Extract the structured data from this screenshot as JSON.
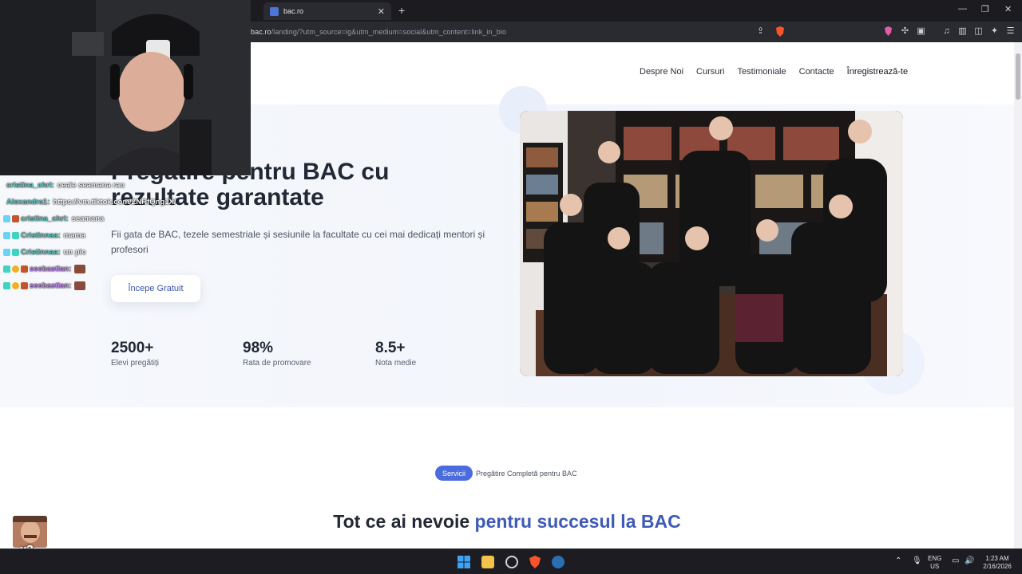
{
  "browser": {
    "tab_title": "bac.ro",
    "url_host": "bac.ro",
    "url_path": "/landing/?utm_source=ig&utm_medium=social&utm_content=link_in_bio"
  },
  "nav": {
    "items": [
      "Despre Noi",
      "Cursuri",
      "Testimoniale",
      "Contacte",
      "Înregistrează-te"
    ]
  },
  "hero": {
    "title": "Pregătire pentru BAC cu rezultate garantate",
    "subtitle": "Fii gata de BAC, tezele semestriale și sesiunile la facultate cu cei mai dedicați mentori și profesori",
    "cta": "Începe Gratuit",
    "stats": [
      {
        "value": "2500+",
        "label": "Elevi pregătiți"
      },
      {
        "value": "98%",
        "label": "Rata de promovare"
      },
      {
        "value": "8.5+",
        "label": "Nota medie"
      }
    ]
  },
  "services": {
    "badge": "Servicii",
    "tagline": "Pregătire Completă pentru BAC",
    "title_start": "Tot ce ai nevoie ",
    "title_highlight": "pentru succesul la BAC"
  },
  "chat": {
    "messages": [
      {
        "user": "cristina_chri:",
        "text": "ceaie seamana rau",
        "color": "#5ec8c0"
      },
      {
        "user": "Alexandra1:",
        "text": "https://vm.tiktok.com/ZNRfQng1X/",
        "color": "#5ec8c0"
      },
      {
        "user": "cristina_chri:",
        "text": "seamana",
        "color": "#5ec8c0"
      },
      {
        "user": "Cristinnaa:",
        "text": "mama",
        "color": "#5ec8c0"
      },
      {
        "user": "Cristinnaa:",
        "text": "un pic",
        "color": "#5ec8c0"
      },
      {
        "user": "seebastian:",
        "text": "",
        "color": "#c389f0"
      },
      {
        "user": "seebastian:",
        "text": "",
        "color": "#c389f0"
      }
    ],
    "emote_count": "x3"
  },
  "taskbar": {
    "lang": "ENG",
    "region": "US",
    "time": "1:23 AM",
    "date": "2/16/2026"
  }
}
